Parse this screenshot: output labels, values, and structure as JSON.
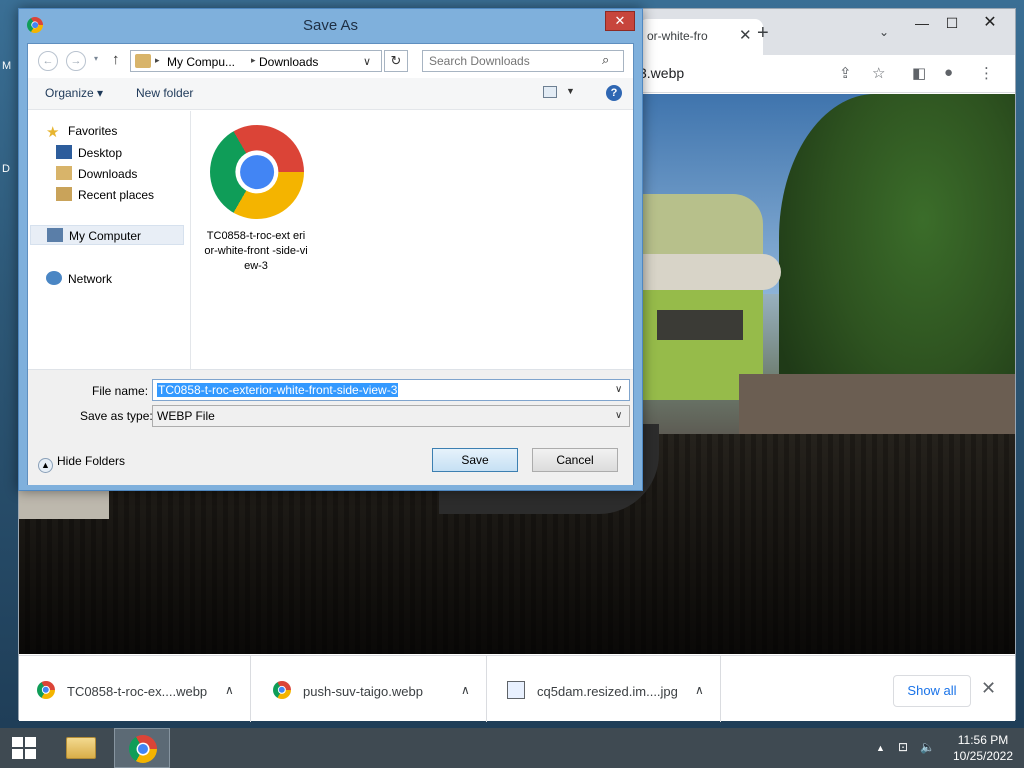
{
  "desktop": {
    "glyph_m": "M",
    "glyph_d": "D"
  },
  "browser": {
    "tab_title": "or-white-fro",
    "tab_close": "✕",
    "new_tab": "+",
    "tab_search": "⌄",
    "minimize": "—",
    "maximize": "☐",
    "close": "✕",
    "url_fragment": "3.webp",
    "share_icon": "⇪",
    "star_icon": "☆",
    "sidepanel_icon": "◧",
    "profile_icon": "●",
    "menu_icon": "⋮"
  },
  "downloads": {
    "items": [
      {
        "name": "TC0858-t-roc-ex....webp",
        "icon": "chrome-icon",
        "chevron": "∧"
      },
      {
        "name": "push-suv-taigo.webp",
        "icon": "chrome-icon",
        "chevron": "∧"
      },
      {
        "name": "cq5dam.resized.im....jpg",
        "icon": "image-file-icon",
        "chevron": "∧"
      }
    ],
    "show_all": "Show all",
    "close": "✕"
  },
  "dialog": {
    "title": "Save As",
    "close": "✕",
    "nav": {
      "back": "←",
      "forward": "→",
      "up": "↑",
      "recent": "▾"
    },
    "breadcrumb": [
      "My Compu...",
      "Downloads"
    ],
    "breadcrumb_sep": "▸",
    "address_dropdown": "∨",
    "refresh": "↻",
    "search_placeholder": "Search Downloads",
    "search_icon": "⌕",
    "toolbar": {
      "organize": "Organize ▾",
      "new_folder": "New folder",
      "view_drop": "▼",
      "help": "?"
    },
    "nav_pane": {
      "favorites": "Favorites",
      "desktop": "Desktop",
      "downloads": "Downloads",
      "recent_places": "Recent places",
      "my_computer": "My Computer",
      "network": "Network"
    },
    "file": {
      "name": "TC0858-t-roc-ext erior-white-front -side-view-3"
    },
    "file_name_label": "File name:",
    "file_name_value": "TC0858-t-roc-exterior-white-front-side-view-3",
    "save_as_type_label": "Save as type:",
    "save_as_type_value": "WEBP File",
    "dropdown": "∨",
    "hide_folders": "Hide Folders",
    "hide_folders_icon": "▲",
    "save": "Save",
    "cancel": "Cancel"
  },
  "taskbar": {
    "tray_chevron": "▲",
    "tray_network": "⊡",
    "tray_volume": "🔈",
    "time": "11:56 PM",
    "date": "10/25/2022"
  }
}
